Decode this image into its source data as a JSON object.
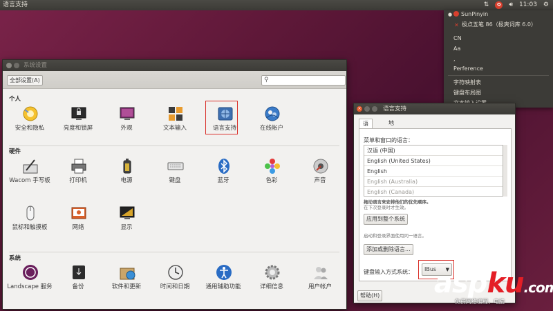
{
  "top_panel": {
    "app_title": "语言支持",
    "indicators": [
      "network-icon",
      "ime-icon",
      "volume-icon"
    ],
    "clock": "11:03"
  },
  "ime_menu": {
    "items": [
      {
        "label": "SunPinyin",
        "selected": true,
        "icon": "sunpinyin-icon"
      },
      {
        "label": "极点五笔 86（极爽词库 6.0）",
        "selected": false,
        "icon": "wubi-icon"
      },
      {
        "label": "CN"
      },
      {
        "label": "Aa"
      },
      {
        "label": ","
      },
      {
        "label": "Perference"
      },
      {
        "label": "字符映射表"
      },
      {
        "label": "键盘布局图"
      },
      {
        "label": "文本输入设置..."
      }
    ]
  },
  "system_settings": {
    "title": "系统设置",
    "all_settings_label": "全部设置(A)",
    "search_placeholder": "",
    "sections": [
      {
        "title": "个人",
        "items": [
          {
            "label": "安全和隐私",
            "icon": "security-privacy-icon"
          },
          {
            "label": "亮度和锁屏",
            "icon": "brightness-lock-icon"
          },
          {
            "label": "外观",
            "icon": "appearance-icon"
          },
          {
            "label": "文本输入",
            "icon": "text-entry-icon"
          },
          {
            "label": "语言支持",
            "icon": "language-support-icon",
            "highlighted": true
          },
          {
            "label": "在线帐户",
            "icon": "online-accounts-icon"
          }
        ]
      },
      {
        "title": "硬件",
        "items": [
          {
            "label": "Wacom 手写板",
            "icon": "wacom-tablet-icon"
          },
          {
            "label": "打印机",
            "icon": "printer-icon"
          },
          {
            "label": "电源",
            "icon": "power-icon"
          },
          {
            "label": "键盘",
            "icon": "keyboard-icon"
          },
          {
            "label": "蓝牙",
            "icon": "bluetooth-icon"
          },
          {
            "label": "色彩",
            "icon": "color-icon"
          },
          {
            "label": "声音",
            "icon": "sound-icon"
          },
          {
            "label": "鼠标和触摸板",
            "icon": "mouse-touchpad-icon"
          },
          {
            "label": "网络",
            "icon": "network-icon"
          },
          {
            "label": "显示",
            "icon": "display-icon"
          }
        ]
      },
      {
        "title": "系统",
        "items": [
          {
            "label": "Landscape 服务",
            "icon": "landscape-icon"
          },
          {
            "label": "备份",
            "icon": "backup-icon"
          },
          {
            "label": "软件和更新",
            "icon": "software-updates-icon"
          },
          {
            "label": "时间和日期",
            "icon": "time-date-icon"
          },
          {
            "label": "通用辅助功能",
            "icon": "universal-access-icon"
          },
          {
            "label": "详细信息",
            "icon": "details-icon"
          },
          {
            "label": "用户帐户",
            "icon": "user-accounts-icon"
          }
        ]
      }
    ]
  },
  "language_support": {
    "title": "语言支持",
    "tabs": [
      "语言",
      "地区格式"
    ],
    "active_tab": 0,
    "list_label": "菜单和窗口的语言：",
    "languages": [
      {
        "label": "汉语 (中国)"
      },
      {
        "label": "English (United States)"
      },
      {
        "label": "English"
      },
      {
        "label": "English (Australia)",
        "faded": true
      },
      {
        "label": "English (Canada)",
        "faded": true
      }
    ],
    "hint_drag": "拖动语言来安排他们的优先顺序。",
    "hint_effect": "在下次登录时才生效。",
    "apply_system_label": "应用到整个系统",
    "hint_login": "启动和登录界面使用同一语言。",
    "add_remove_label": "添加或删除语言...",
    "ime_label": "键盘输入方式系统：",
    "ime_value": "IBus",
    "help_label": "帮助(H)"
  },
  "watermark": {
    "main_prefix": "asp",
    "main_red": "ku",
    "main_suffix": ".com",
    "sub": "免费网络编程、电脑"
  }
}
